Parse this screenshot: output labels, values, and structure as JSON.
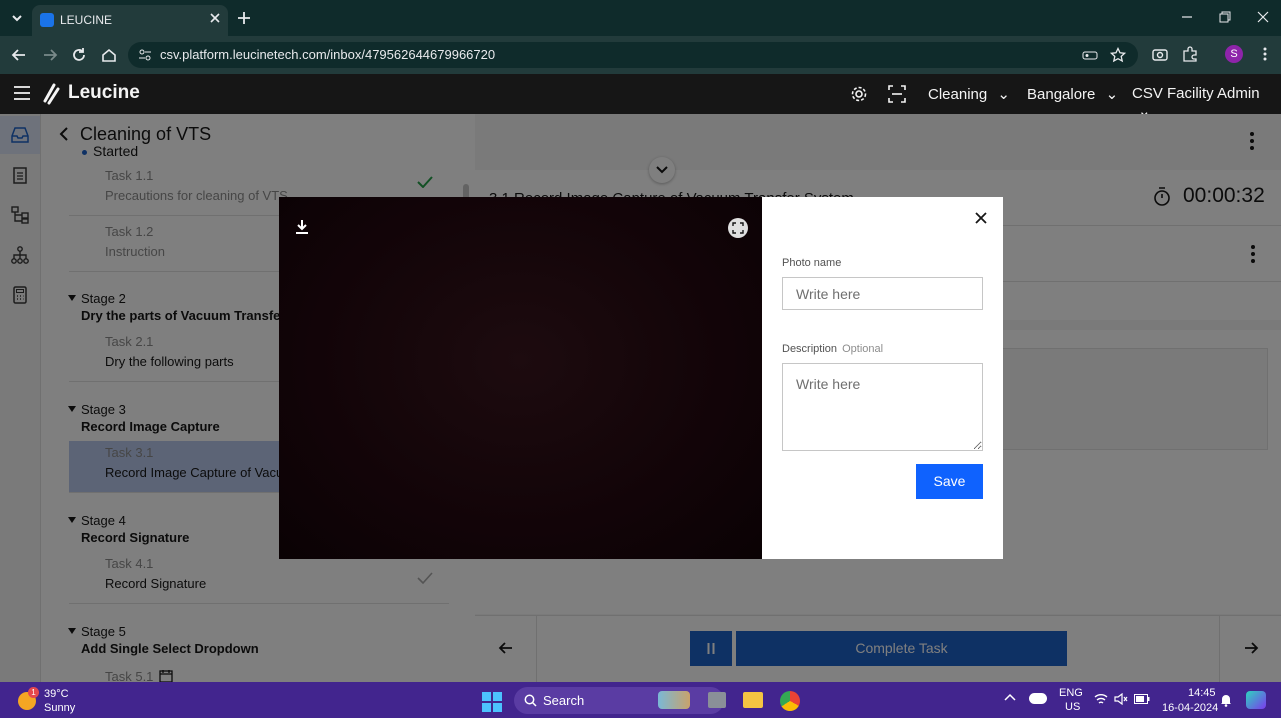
{
  "browser": {
    "tab_title": "LEUCINE",
    "url": "csv.platform.leucinetech.com/inbox/479562644679966720",
    "profile_initial": "S"
  },
  "app": {
    "brand": "Leucine",
    "header_selects": [
      {
        "label": "Cleaning"
      },
      {
        "label": "Bangalore"
      },
      {
        "label": "CSV Facility Admin"
      }
    ]
  },
  "job": {
    "title": "Cleaning of VTS",
    "status": "Started",
    "status_color": "#1d62c9"
  },
  "stages": [
    {
      "tasks": [
        {
          "number": "Task 1.1",
          "name": "Precautions for cleaning of VTS"
        },
        {
          "number": "Task 1.2",
          "name": "Instruction"
        }
      ]
    },
    {
      "label": "Stage 2",
      "name": "Dry the parts of Vacuum Transfer Sy",
      "tasks": [
        {
          "number": "Task 2.1",
          "name": "Dry the following parts"
        }
      ]
    },
    {
      "label": "Stage 3",
      "name": "Record Image Capture",
      "tasks": [
        {
          "number": "Task 3.1",
          "name": "Record Image Capture of Vacuum"
        }
      ]
    },
    {
      "label": "Stage 4",
      "name": "Record Signature",
      "tasks": [
        {
          "number": "Task 4.1",
          "name": "Record Signature"
        }
      ]
    },
    {
      "label": "Stage 5",
      "name": "Add Single Select Dropdown",
      "tasks": [
        {
          "number": "Task 5.1",
          "name": ""
        }
      ]
    }
  ],
  "task_view": {
    "title": "3.1 Record Image Capture of Vacuum Transfer System",
    "timer": "00:00:32",
    "complete_label": "Complete Task"
  },
  "modal": {
    "photo_name_label": "Photo name",
    "photo_name_placeholder": "Write here",
    "description_label": "Description",
    "description_optional": "Optional",
    "description_placeholder": "Write here",
    "save_label": "Save"
  },
  "taskbar": {
    "weather_temp": "39°C",
    "weather_desc": "Sunny",
    "weather_badge": "1",
    "search_label": "Search",
    "lang": "ENG",
    "region": "US",
    "time": "14:45",
    "date": "16-04-2024"
  },
  "colors": {
    "accent": "#1d62c9",
    "app_header": "#161616",
    "taskbar": "#42258e",
    "chrome": "#223b3b"
  }
}
